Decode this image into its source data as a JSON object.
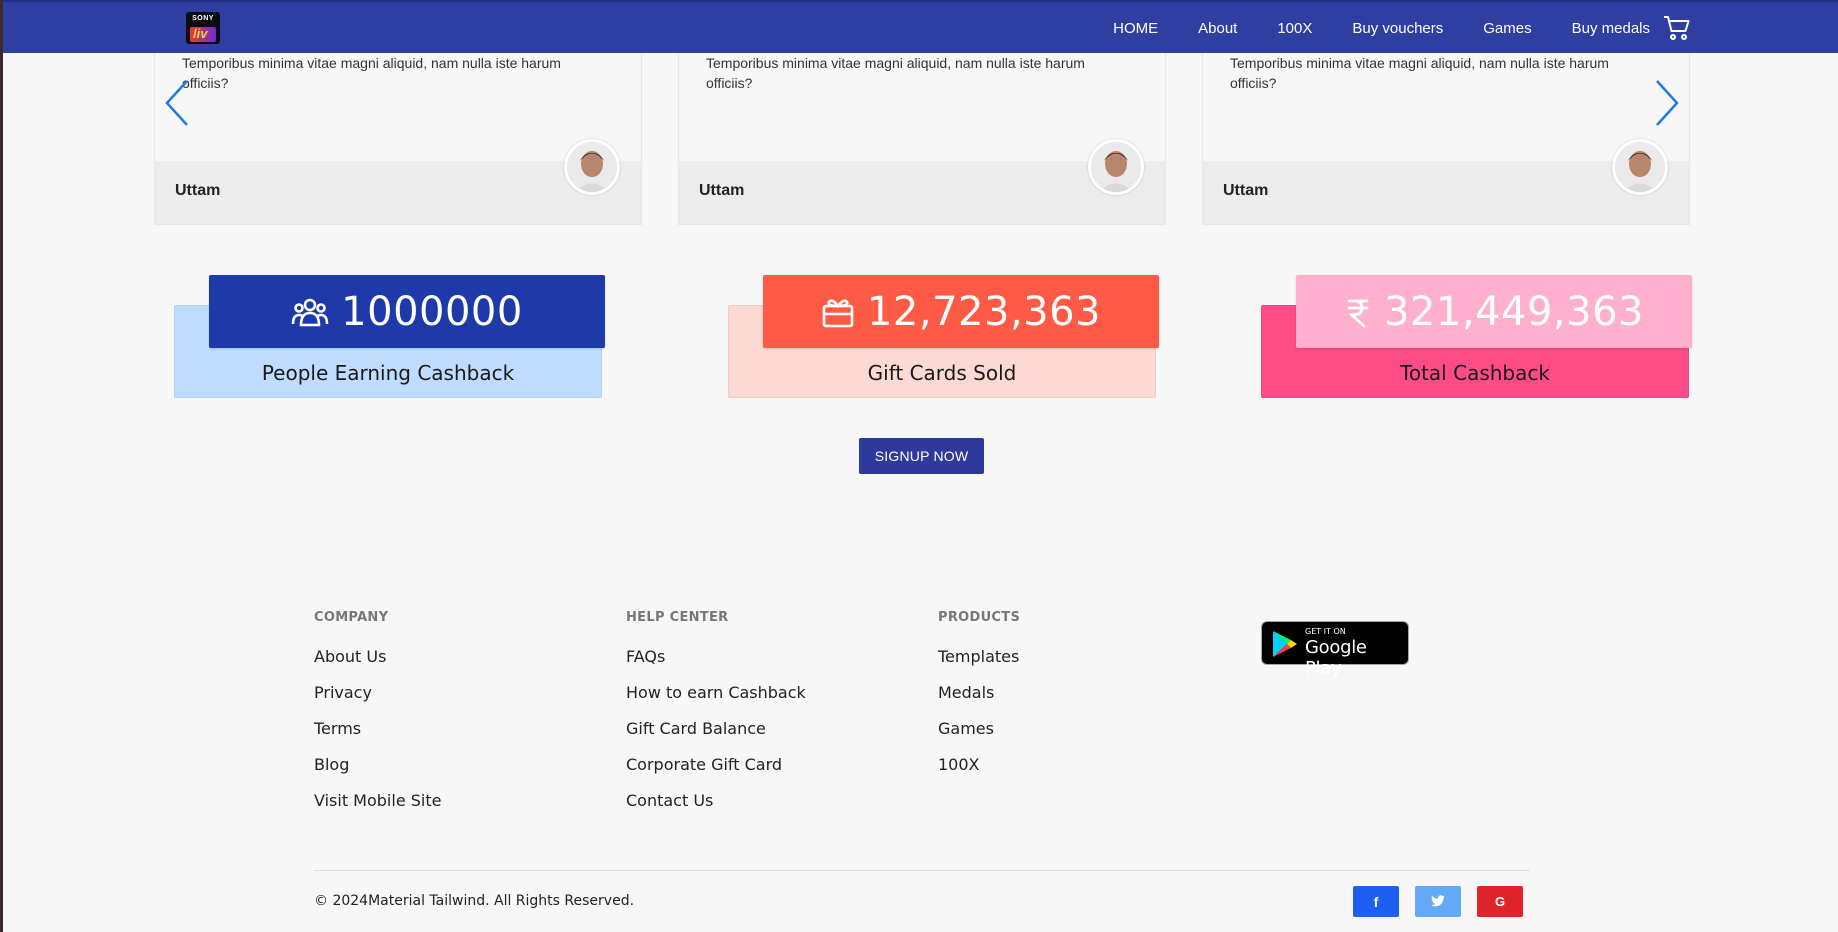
{
  "nav": {
    "logo_top": "SONY",
    "logo_bottom": "liv",
    "items": [
      "HOME",
      "About",
      "100X",
      "Buy vouchers",
      "Games",
      "Buy medals"
    ]
  },
  "testimonials": [
    {
      "quote": "Temporibus minima vitae magni aliquid, nam nulla iste harum officiis?",
      "author": "Uttam"
    },
    {
      "quote": "Temporibus minima vitae magni aliquid, nam nulla iste harum officiis?",
      "author": "Uttam"
    },
    {
      "quote": "Temporibus minima vitae magni aliquid, nam nulla iste harum officiis?",
      "author": "Uttam"
    }
  ],
  "stats": [
    {
      "value": "1000000",
      "label": "People Earning Cashback",
      "icon": "users-icon",
      "front_color": "#1e3aa8",
      "back_color": "#bfdbfe"
    },
    {
      "value": "12,723,363",
      "label": "Gift Cards Sold",
      "icon": "gift-icon",
      "front_color": "#ff5a45",
      "back_color": "#fdd9d3"
    },
    {
      "value": "321,449,363",
      "label": "Total Cashback",
      "icon": "rupee-icon",
      "front_color": "#feb0cc",
      "back_color": "#ff4b86"
    }
  ],
  "cta": {
    "signup": "SIGNUP NOW"
  },
  "footer": {
    "company": {
      "heading": "COMPANY",
      "links": [
        "About Us",
        "Privacy",
        "Terms",
        "Blog",
        "Visit Mobile Site"
      ]
    },
    "help": {
      "heading": "HELP CENTER",
      "links": [
        "FAQs",
        "How to earn Cashback",
        "Gift Card Balance",
        "Corporate Gift Card",
        "Contact Us"
      ]
    },
    "products": {
      "heading": "PRODUCTS",
      "links": [
        "Templates",
        "Medals",
        "Games",
        "100X"
      ]
    },
    "google_play": {
      "small": "GET IT ON",
      "big": "Google Play"
    },
    "copyright": "© 2024Material Tailwind. All Rights Reserved.",
    "social": [
      {
        "icon": "facebook-icon",
        "glyph": "f",
        "color": "#1d5ff0"
      },
      {
        "icon": "twitter-icon",
        "glyph": "t",
        "color": "#63a9f5"
      },
      {
        "icon": "google-icon",
        "glyph": "G",
        "color": "#e0242c"
      }
    ]
  }
}
